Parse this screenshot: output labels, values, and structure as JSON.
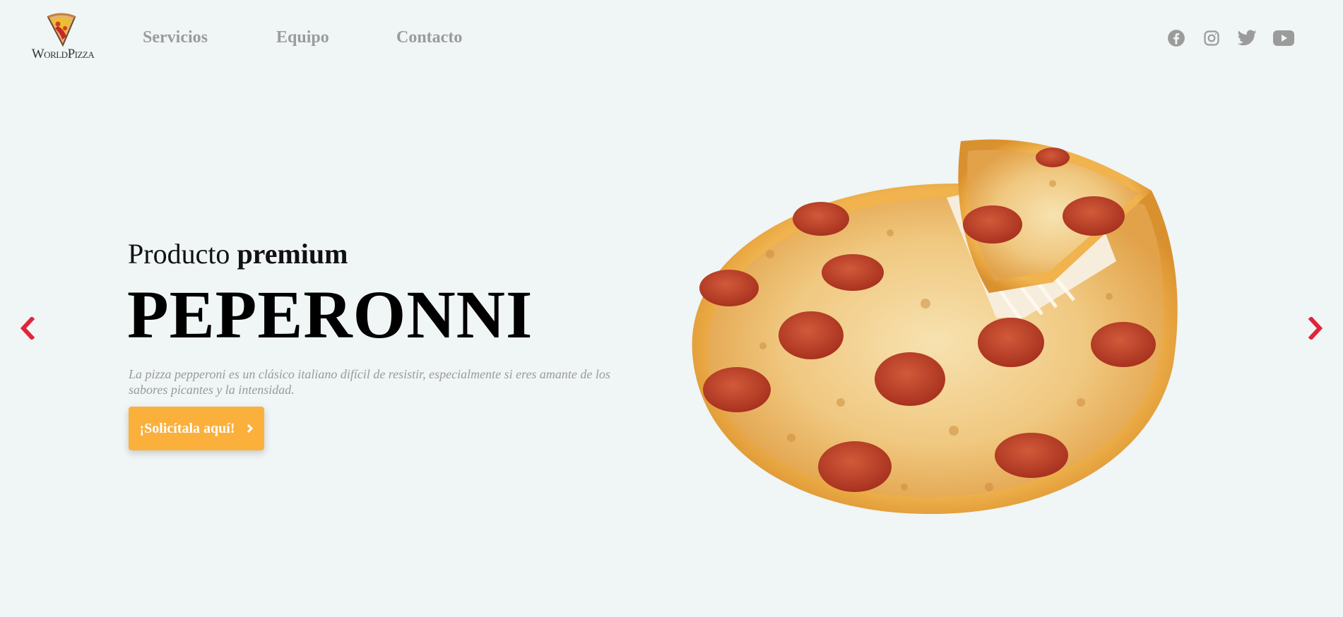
{
  "brand": {
    "name": "WorldPizza"
  },
  "nav": {
    "items": [
      {
        "label": "Servicios"
      },
      {
        "label": "Equipo"
      },
      {
        "label": "Contacto"
      }
    ]
  },
  "social": [
    "facebook-icon",
    "instagram-icon",
    "twitter-icon",
    "youtube-icon"
  ],
  "hero": {
    "subtitle_regular": "Producto ",
    "subtitle_bold": "premium",
    "title": "PEPERONNI",
    "description": "La pizza pepperoni es un clásico italiano difícil de resistir, especialmente si eres amante de los sabores picantes y la intensidad.",
    "cta_label": "¡Solicítala aquí!"
  },
  "colors": {
    "background": "#f0f5f5",
    "accent": "#fbb03b",
    "arrow": "#e0243a",
    "nav": "#9b9b9b"
  }
}
